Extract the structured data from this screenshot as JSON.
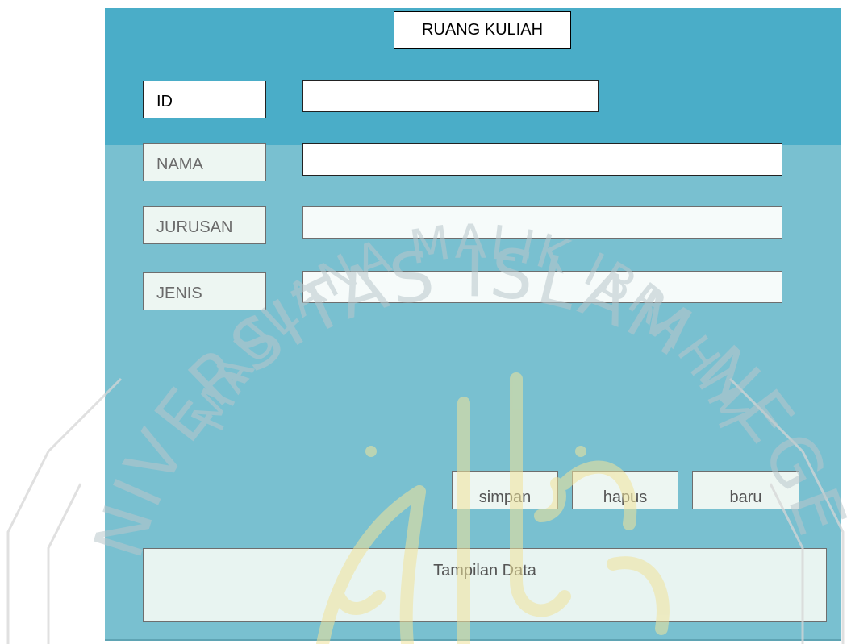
{
  "form": {
    "title": "RUANG KULIAH",
    "fields": [
      {
        "label": "ID",
        "value": ""
      },
      {
        "label": "NAMA",
        "value": ""
      },
      {
        "label": "JURUSAN",
        "value": ""
      },
      {
        "label": "JENIS",
        "value": ""
      }
    ],
    "buttons": {
      "save": "simpan",
      "delete": "hapus",
      "new": "baru"
    },
    "data_view": "Tampilan Data"
  },
  "watermark": {
    "text_outer": "UNIVERSITAS ISLAM NEGERI",
    "text_inner": "MAULANA MALIK IBRAHIM"
  },
  "colors": {
    "header": "#4aadc8",
    "panel": "#79c0d0"
  }
}
